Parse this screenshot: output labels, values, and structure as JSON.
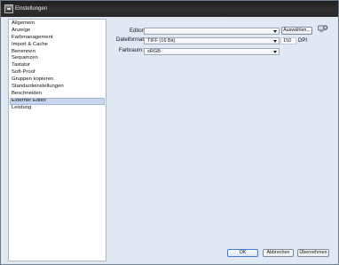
{
  "window": {
    "title": "Einstellungen"
  },
  "sidebar": {
    "items": [
      {
        "label": "Allgemein",
        "selected": false
      },
      {
        "label": "Anzeige",
        "selected": false
      },
      {
        "label": "Farbmanagement",
        "selected": false
      },
      {
        "label": "Import & Cache",
        "selected": false
      },
      {
        "label": "Benennen",
        "selected": false
      },
      {
        "label": "Sequenzen",
        "selected": false
      },
      {
        "label": "Tastatur",
        "selected": false
      },
      {
        "label": "Soft-Proof",
        "selected": false
      },
      {
        "label": "Gruppen kopieren",
        "selected": false
      },
      {
        "label": "Standardeinstellungen",
        "selected": false
      },
      {
        "label": "Beschneiden",
        "selected": false
      },
      {
        "label": "Externer Editor",
        "selected": true
      },
      {
        "label": "Leistung",
        "selected": false
      }
    ]
  },
  "form": {
    "editor_label": "Editor:",
    "editor_value": "",
    "browse_label": "Auswählen...",
    "format_label": "Dateiformat:",
    "format_value": "TIFF (16 Bit)",
    "dpi_value": "150",
    "dpi_unit": "DPI",
    "colorspace_label": "Farbraum:",
    "colorspace_value": "sRGB"
  },
  "footer": {
    "ok_label": "OK",
    "cancel_label": "Abbrechen",
    "apply_label": "Übernehmen"
  },
  "icons": {
    "app": "app-icon",
    "settings": "gear-icon"
  }
}
